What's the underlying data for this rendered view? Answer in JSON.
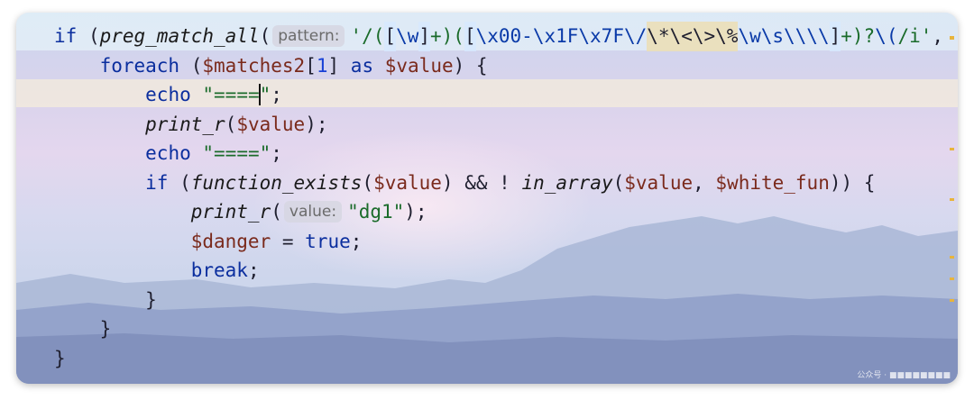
{
  "editor": {
    "lines": [
      {
        "parts": [
          [
            "kw",
            "if"
          ],
          [
            "t",
            " ("
          ],
          [
            "fn",
            "preg_match_all"
          ],
          [
            "t",
            "("
          ],
          [
            "hint",
            "pattern:"
          ],
          [
            "str",
            "'/("
          ],
          [
            "hl",
            "["
          ],
          [
            "esc",
            "\\w"
          ],
          [
            "hl",
            "]"
          ],
          [
            "str",
            "+)("
          ],
          [
            "hl",
            "["
          ],
          [
            "esc",
            "\\x00-\\x1F\\x7F\\/"
          ],
          [
            "hlw",
            "\\*\\<\\>\\%"
          ],
          [
            "esc",
            "\\w\\s\\\\\\\\"
          ],
          [
            "hl",
            "]"
          ],
          [
            "str",
            "+)?"
          ],
          [
            "esc",
            "\\("
          ],
          [
            "str",
            "/i'"
          ],
          [
            "t",
            ","
          ]
        ]
      },
      {
        "parts": [
          [
            "t",
            "    "
          ],
          [
            "kw",
            "foreach"
          ],
          [
            "t",
            " ("
          ],
          [
            "var",
            "$matches2"
          ],
          [
            "t",
            "["
          ],
          [
            "num",
            "1"
          ],
          [
            "t",
            "] "
          ],
          [
            "kw",
            "as"
          ],
          [
            "t",
            " "
          ],
          [
            "var",
            "$value"
          ],
          [
            "t",
            ") {"
          ]
        ]
      },
      {
        "parts": [
          [
            "t",
            "        "
          ],
          [
            "kw",
            "echo"
          ],
          [
            "t",
            " "
          ],
          [
            "str",
            "\"===="
          ],
          [
            "caret",
            ""
          ],
          [
            "str",
            "\""
          ],
          [
            "t",
            ";"
          ]
        ]
      },
      {
        "parts": [
          [
            "t",
            "        "
          ],
          [
            "fn",
            "print_r"
          ],
          [
            "t",
            "("
          ],
          [
            "var",
            "$value"
          ],
          [
            "t",
            ");"
          ]
        ]
      },
      {
        "parts": [
          [
            "t",
            "        "
          ],
          [
            "kw",
            "echo"
          ],
          [
            "t",
            " "
          ],
          [
            "str",
            "\"====\""
          ],
          [
            "t",
            ";"
          ]
        ]
      },
      {
        "parts": [
          [
            "t",
            "        "
          ],
          [
            "kw",
            "if"
          ],
          [
            "t",
            " ("
          ],
          [
            "fn",
            "function_exists"
          ],
          [
            "t",
            "("
          ],
          [
            "var",
            "$value"
          ],
          [
            "t",
            ") && ! "
          ],
          [
            "fn",
            "in_array"
          ],
          [
            "t",
            "("
          ],
          [
            "var",
            "$value"
          ],
          [
            "t",
            ", "
          ],
          [
            "var",
            "$white_fun"
          ],
          [
            "t",
            ")) {"
          ]
        ]
      },
      {
        "parts": [
          [
            "t",
            "            "
          ],
          [
            "fn",
            "print_r"
          ],
          [
            "t",
            "("
          ],
          [
            "hint",
            "value:"
          ],
          [
            "str",
            "\"dg1\""
          ],
          [
            "t",
            ");"
          ]
        ]
      },
      {
        "parts": [
          [
            "t",
            "            "
          ],
          [
            "var",
            "$danger"
          ],
          [
            "t",
            " = "
          ],
          [
            "kw",
            "true"
          ],
          [
            "t",
            ";"
          ]
        ]
      },
      {
        "parts": [
          [
            "t",
            "            "
          ],
          [
            "kw",
            "break"
          ],
          [
            "t",
            ";"
          ]
        ]
      },
      {
        "parts": [
          [
            "t",
            "        }"
          ]
        ]
      },
      {
        "parts": [
          [
            "t",
            "    }"
          ]
        ]
      },
      {
        "parts": [
          [
            "t",
            "}"
          ]
        ]
      }
    ],
    "watermark": "公众号 · ■■■■■■■■"
  }
}
